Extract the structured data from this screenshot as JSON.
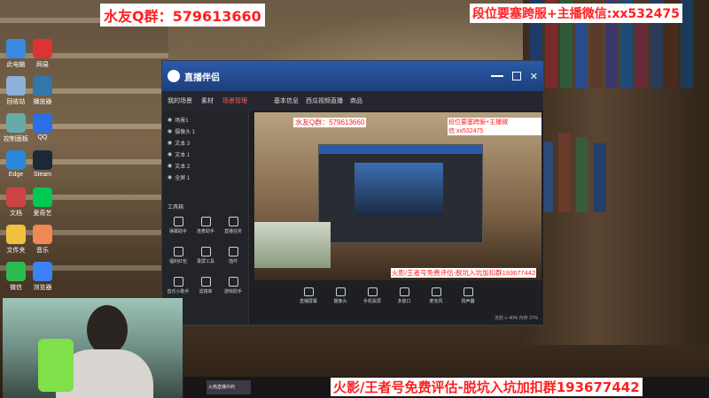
{
  "overlay": {
    "top_left": "水友Q群：579613660",
    "top_right": "段位要塞跨服+主播微信:xx532475",
    "bottom": "火影/王者号免费评估-脱坑入坑加扣群193677442",
    "colors": {
      "red": "#ff2020",
      "bg": "#ffffff"
    }
  },
  "desktop": {
    "icons": [
      {
        "label": "此电脑",
        "color": "#3a8be0"
      },
      {
        "label": "网易",
        "color": "#d33"
      },
      {
        "label": "回收站",
        "color": "#8fb0d8"
      },
      {
        "label": "播放器",
        "color": "#37a"
      },
      {
        "label": "控制面板",
        "color": "#6aa"
      },
      {
        "label": "QQ",
        "color": "#2b6fe8"
      },
      {
        "label": "Edge",
        "color": "#2a88d8"
      },
      {
        "label": "Steam",
        "color": "#1b2838"
      },
      {
        "label": "文档",
        "color": "#c44"
      },
      {
        "label": "爱奇艺",
        "color": "#00c853"
      },
      {
        "label": "文件夹",
        "color": "#f0c040"
      },
      {
        "label": "音乐",
        "color": "#e85"
      },
      {
        "label": "微信",
        "color": "#2dbb4e"
      },
      {
        "label": "浏览器",
        "color": "#3b82f6"
      }
    ]
  },
  "app": {
    "name": "直播伴侣",
    "tabs": [
      "我的场景",
      "素材",
      "场景管理"
    ],
    "top_tabs": [
      "基本信息",
      "西瓜视频直播",
      "商品"
    ],
    "scenes": [
      {
        "label": "场景1"
      },
      {
        "label": "摄像头 1"
      },
      {
        "label": "文本 3"
      },
      {
        "label": "文本 1"
      },
      {
        "label": "文本 2"
      },
      {
        "label": "全屏 1"
      }
    ],
    "tools_header": "工具箱",
    "tools": [
      {
        "label": "弹幕助手"
      },
      {
        "label": "连麦助手"
      },
      {
        "label": "直播任务"
      },
      {
        "label": "福利红包"
      },
      {
        "label": "录屏工具"
      },
      {
        "label": "插件"
      },
      {
        "label": "音乐小助手"
      },
      {
        "label": "滤镜库"
      },
      {
        "label": "游戏助手"
      }
    ],
    "bottom_buttons": [
      {
        "label": "直播屏幕"
      },
      {
        "label": "摄像头"
      },
      {
        "label": "手机投屏"
      },
      {
        "label": "多窗口"
      },
      {
        "label": "麦克风"
      },
      {
        "label": "扬声器"
      }
    ],
    "status": "当前 ∞ 40%   内存 37%",
    "taskbar_item": "火热直播中的"
  }
}
